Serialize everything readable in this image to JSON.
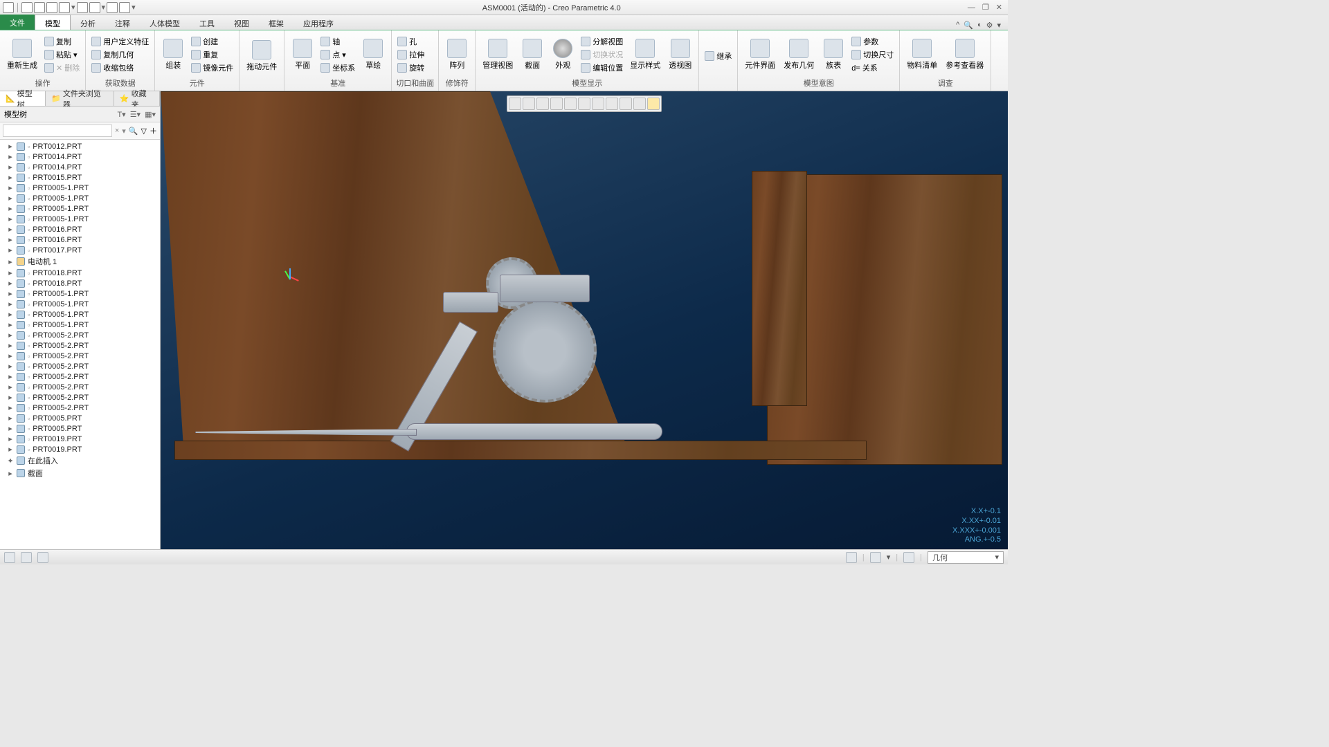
{
  "title": "ASM0001 (活动的) - Creo Parametric 4.0",
  "window_controls": {
    "min": "—",
    "max": "❐",
    "close": "✕"
  },
  "menu_tabs": {
    "file": "文件",
    "items": [
      "模型",
      "分析",
      "注释",
      "人体模型",
      "工具",
      "视图",
      "框架",
      "应用程序"
    ],
    "active": "模型"
  },
  "ribbon": {
    "g1": {
      "label": "操作",
      "regen": "重新生成",
      "copy": "复制",
      "paste": "粘贴",
      "delete": "删除"
    },
    "g2": {
      "label": "获取数据",
      "udf": "用户定义特征",
      "copygeom": "复制几何",
      "shrinkwrap": "收缩包络"
    },
    "g3": {
      "label": "元件",
      "assemble": "组装",
      "create": "创建",
      "repeat": "重复",
      "mirror": "镜像元件"
    },
    "g4": {
      "label": "拖动元件"
    },
    "g5": {
      "label": "基准",
      "plane": "平面",
      "axis": "轴",
      "point": "点",
      "csys": "坐标系",
      "sketch": "草绘"
    },
    "g6": {
      "label": "切口和曲面",
      "hole": "孔",
      "pull": "拉伸",
      "revolve": "旋转"
    },
    "g7": {
      "label": "修饰符",
      "pattern": "阵列"
    },
    "g8": {
      "label": "模型显示",
      "manage": "管理视图",
      "section": "截面",
      "appearance": "外观",
      "exploded": "分解视图",
      "switch": "切换状况",
      "edit": "编辑位置",
      "style": "显示样式",
      "persp": "透视图"
    },
    "g9": {
      "label": "",
      "inherit": "继承"
    },
    "g10": {
      "label": "模型意图",
      "compui": "元件界面",
      "publish": "发布几何",
      "family": "族表",
      "param": "参数",
      "switchd": "切换尺寸",
      "rel": "d= 关系"
    },
    "g11": {
      "label": "调查",
      "bom": "物料清单",
      "refview": "参考查看器"
    }
  },
  "sidepanel": {
    "tabs": [
      "模型树",
      "文件夹浏览器",
      "收藏夹"
    ],
    "title": "模型树",
    "search_placeholder": "",
    "items": [
      "PRT0012.PRT",
      "PRT0014.PRT",
      "PRT0014.PRT",
      "PRT0015.PRT",
      "PRT0005-1.PRT",
      "PRT0005-1.PRT",
      "PRT0005-1.PRT",
      "PRT0005-1.PRT",
      "PRT0016.PRT",
      "PRT0016.PRT",
      "PRT0017.PRT",
      "电动机 1",
      "PRT0018.PRT",
      "PRT0018.PRT",
      "PRT0005-1.PRT",
      "PRT0005-1.PRT",
      "PRT0005-1.PRT",
      "PRT0005-1.PRT",
      "PRT0005-2.PRT",
      "PRT0005-2.PRT",
      "PRT0005-2.PRT",
      "PRT0005-2.PRT",
      "PRT0005-2.PRT",
      "PRT0005-2.PRT",
      "PRT0005-2.PRT",
      "PRT0005-2.PRT",
      "PRT0005.PRT",
      "PRT0005.PRT",
      "PRT0019.PRT",
      "PRT0019.PRT",
      "在此插入",
      "截面"
    ]
  },
  "hud": {
    "l1": "X.X+-0.1",
    "l2": "X.XX+-0.01",
    "l3": "X.XXX+-0.001",
    "l4": "ANG.+-0.5"
  },
  "statusbar": {
    "selector": "几何"
  }
}
